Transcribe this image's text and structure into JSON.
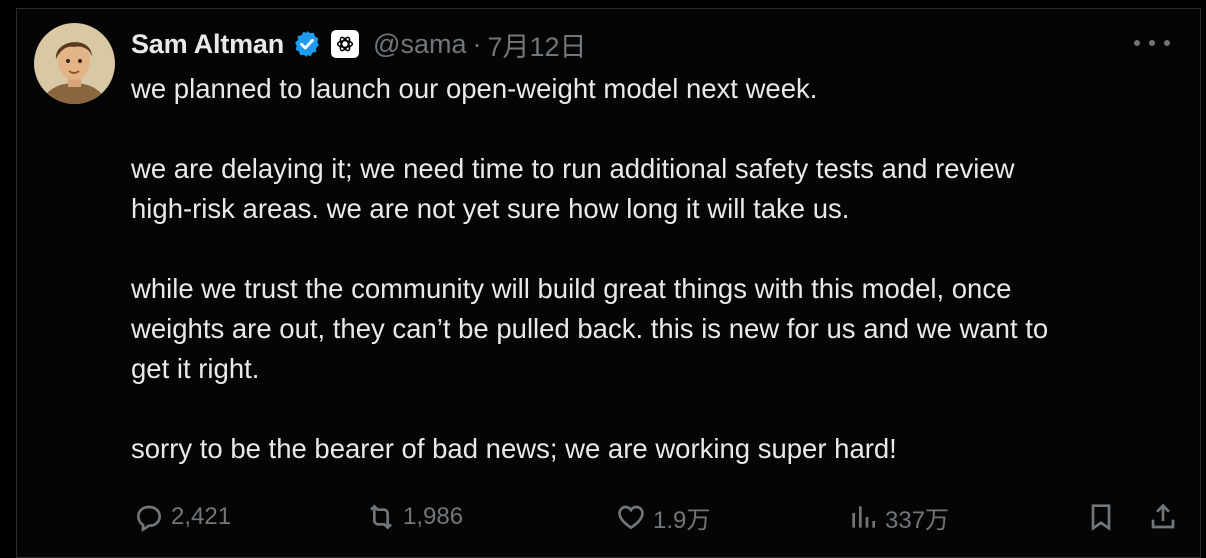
{
  "tweet": {
    "author": {
      "name": "Sam Altman",
      "handle": "@sama",
      "separator": "·",
      "date": "7月12日",
      "verified_icon": "verified-badge-icon",
      "affiliation_icon": "openai-logo-icon"
    },
    "paragraphs": [
      [
        "we planned to launch our open-weight model next week."
      ],
      [
        "we are delaying it; we need time to run additional safety tests and review",
        "high-risk areas. we are not yet sure how long it will take us."
      ],
      [
        "while we trust the community will build great things with this model, once",
        "weights are out, they can’t be pulled back. this is new for us and we want to",
        "get it right."
      ],
      [
        "sorry to be the bearer of bad news; we are working super hard!"
      ]
    ],
    "actions": {
      "reply": {
        "icon": "reply-icon",
        "count": "2,421"
      },
      "repost": {
        "icon": "repost-icon",
        "count": "1,986"
      },
      "like": {
        "icon": "heart-icon",
        "count": "1.9万"
      },
      "views": {
        "icon": "views-icon",
        "count": "337万"
      },
      "bookmark": {
        "icon": "bookmark-icon"
      },
      "share": {
        "icon": "share-icon"
      }
    }
  },
  "colors": {
    "background": "#000000",
    "text": "#e7e9ea",
    "muted": "#71767b",
    "verified": "#1d9bf0"
  }
}
